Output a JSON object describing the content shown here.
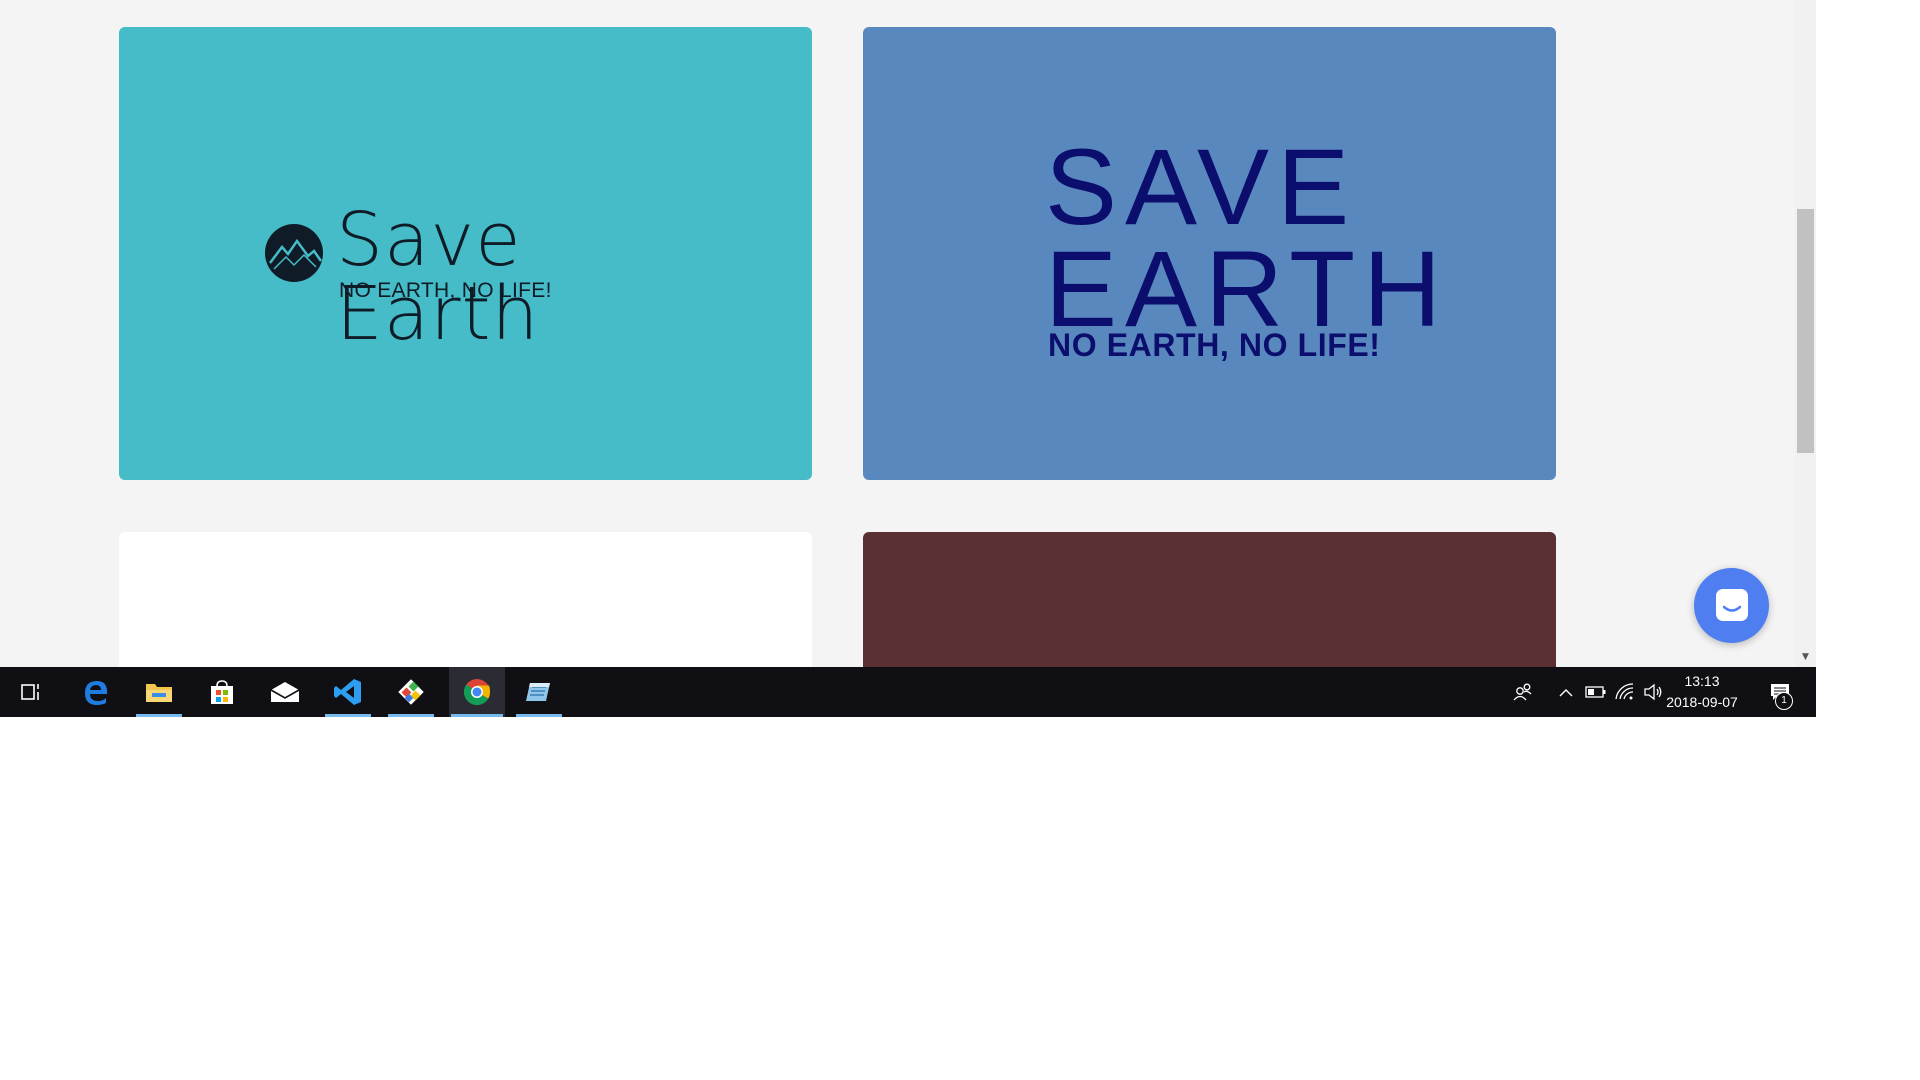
{
  "cards": [
    {
      "background": "#45bcc7",
      "logo_name": "Save Earth",
      "logo_tagline": "NO EARTH, NO LIFE!",
      "logo_color": "#0f1b26"
    },
    {
      "background": "#5988bf",
      "logo_line1": "SAVE",
      "logo_line2": "EARTH",
      "logo_tagline": "NO EARTH, NO LIFE!",
      "logo_color": "#0c0e6e"
    },
    {
      "background": "#ffffff"
    },
    {
      "background": "#5b3032"
    }
  ],
  "taskbar": {
    "apps": [
      {
        "icon": "task-view-icon"
      },
      {
        "icon": "edge-icon"
      },
      {
        "icon": "file-explorer-icon"
      },
      {
        "icon": "store-icon"
      },
      {
        "icon": "mail-icon"
      },
      {
        "icon": "vscode-icon"
      },
      {
        "icon": "git-icon"
      },
      {
        "icon": "chrome-icon"
      },
      {
        "icon": "notepad-icon"
      }
    ],
    "time": "13:13",
    "date": "2018-09-07",
    "notification_count": "1"
  }
}
